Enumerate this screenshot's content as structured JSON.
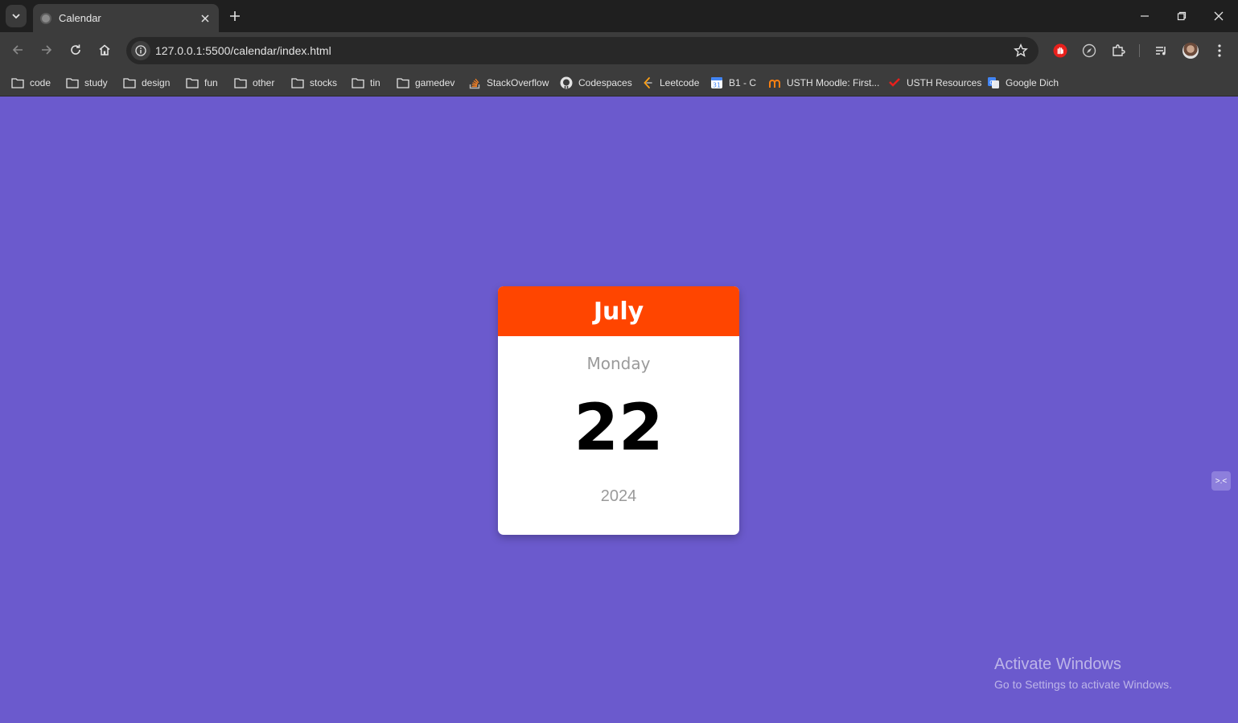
{
  "browser": {
    "tab": {
      "title": "Calendar"
    },
    "url": "127.0.0.1:5500/calendar/index.html",
    "bookmarks": [
      {
        "label": "code",
        "icon": "folder-icon"
      },
      {
        "label": "study",
        "icon": "folder-icon"
      },
      {
        "label": "design",
        "icon": "folder-icon"
      },
      {
        "label": "fun",
        "icon": "folder-icon"
      },
      {
        "label": "other",
        "icon": "folder-icon"
      },
      {
        "label": "stocks",
        "icon": "folder-icon"
      },
      {
        "label": "tin",
        "icon": "folder-icon"
      },
      {
        "label": "gamedev",
        "icon": "folder-icon"
      },
      {
        "label": "StackOverflow",
        "icon": "stackoverflow-icon"
      },
      {
        "label": "Codespaces",
        "icon": "github-icon"
      },
      {
        "label": "Leetcode",
        "icon": "leetcode-icon"
      },
      {
        "label": "B1 - C",
        "icon": "calendar-icon"
      },
      {
        "label": "USTH Moodle: First...",
        "icon": "moodle-icon"
      },
      {
        "label": "USTH Resources",
        "icon": "check-icon"
      },
      {
        "label": "Google Dich",
        "icon": "translate-icon"
      }
    ]
  },
  "calendar": {
    "month": "July",
    "weekday": "Monday",
    "day": "22",
    "year": "2024"
  },
  "widget": {
    "label": ">.<"
  },
  "watermark": {
    "title": "Activate Windows",
    "subtitle": "Go to Settings to activate Windows."
  },
  "colors": {
    "page_background": "#6b5acd",
    "month_header": "#ff4500",
    "card": "#ffffff"
  }
}
